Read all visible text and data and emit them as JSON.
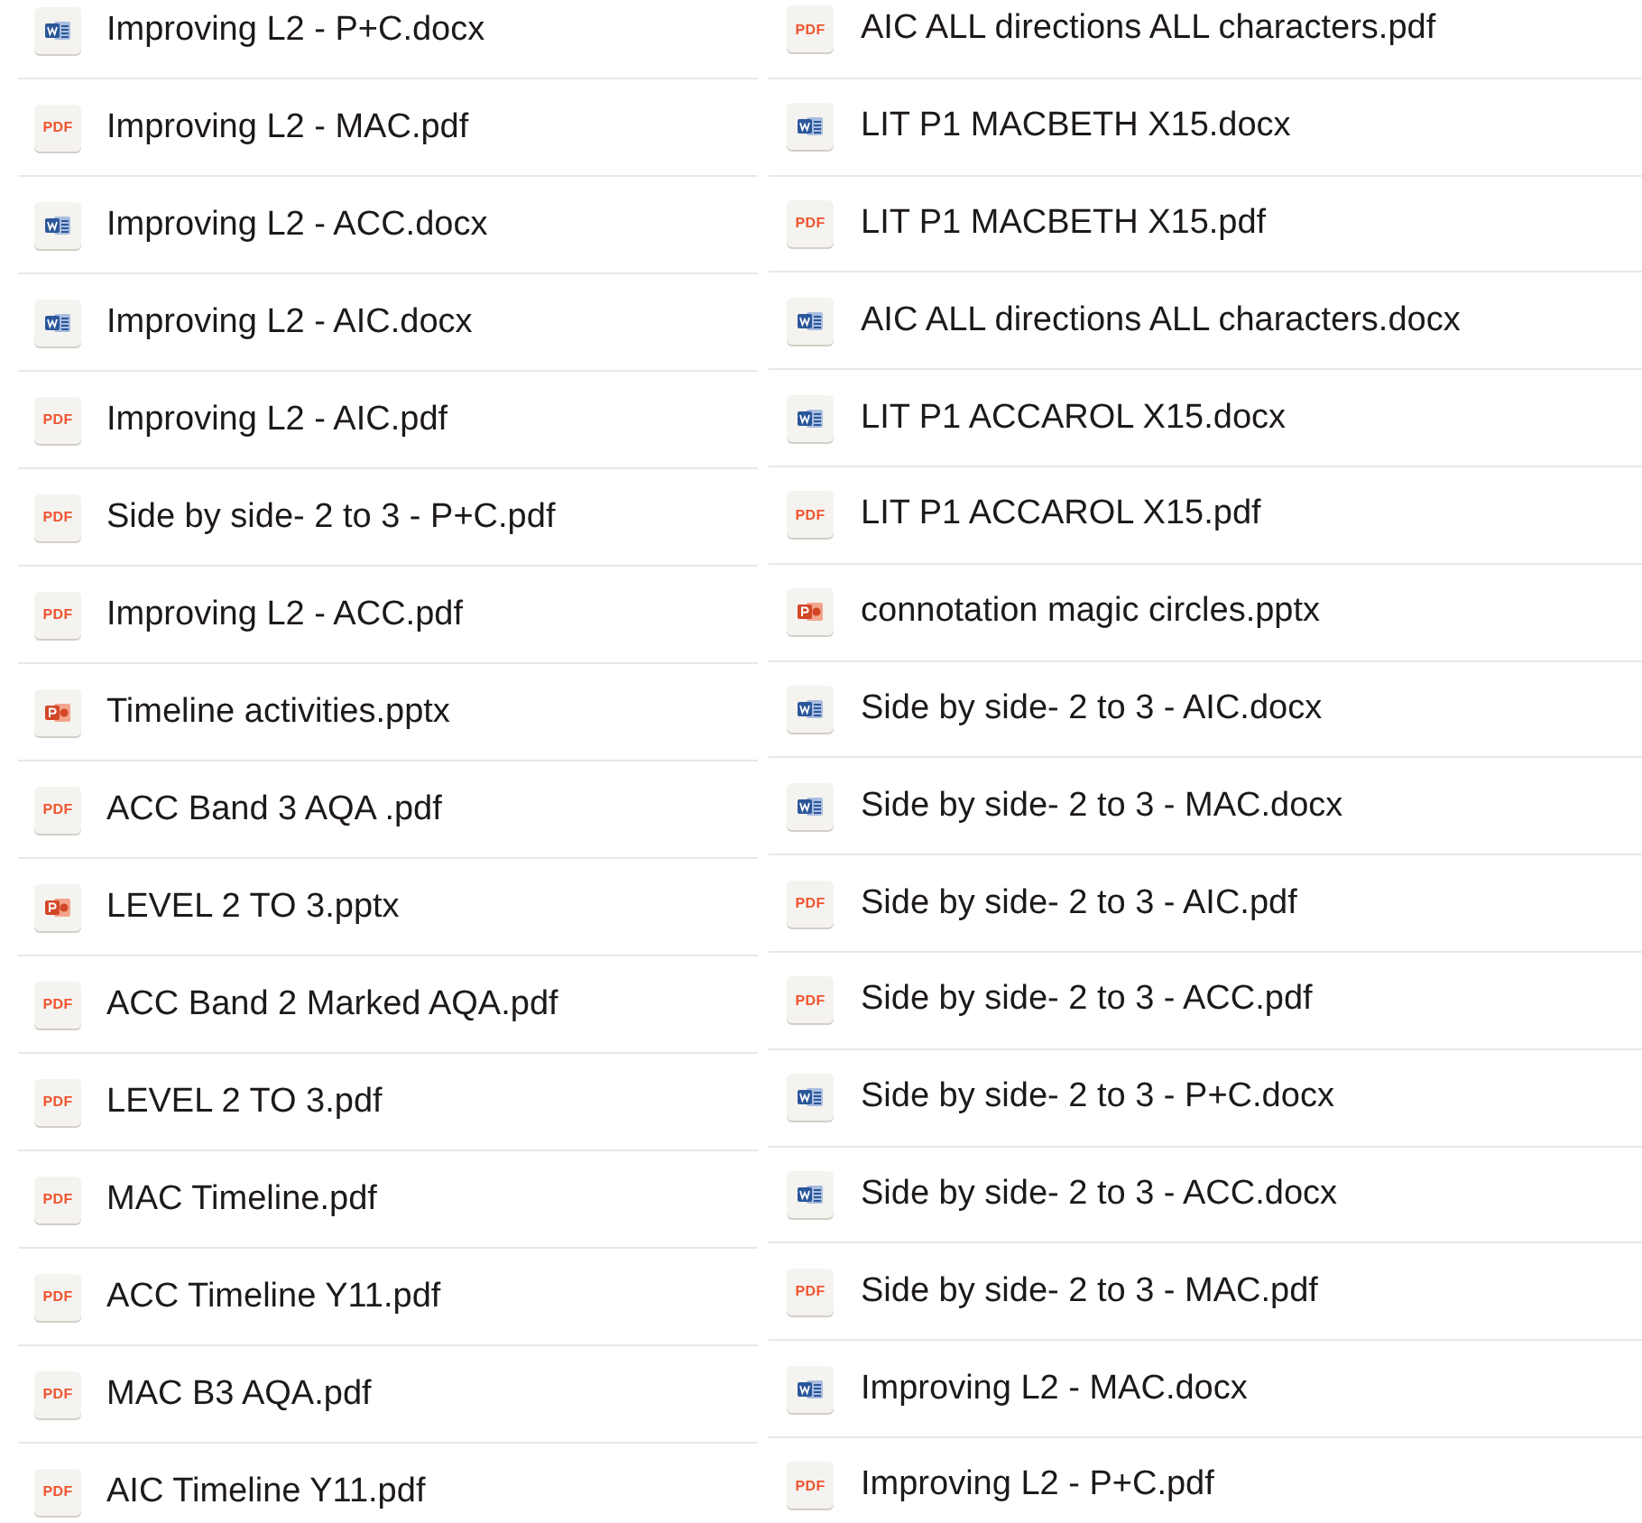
{
  "columns": [
    {
      "files": [
        {
          "name": "Improving L2 - P+C.docx",
          "kind": "docx"
        },
        {
          "name": "Improving L2 - MAC.pdf",
          "kind": "pdf",
          "badge": "PDF"
        },
        {
          "name": "Improving L2 - ACC.docx",
          "kind": "docx"
        },
        {
          "name": "Improving L2 - AIC.docx",
          "kind": "docx"
        },
        {
          "name": "Improving L2 - AIC.pdf",
          "kind": "pdf",
          "badge": "PDF"
        },
        {
          "name": "Side by side- 2 to 3 - P+C.pdf",
          "kind": "pdf",
          "badge": "PDF"
        },
        {
          "name": "Improving L2 - ACC.pdf",
          "kind": "pdf",
          "badge": "PDF"
        },
        {
          "name": "Timeline activities.pptx",
          "kind": "pptx"
        },
        {
          "name": "ACC Band 3 AQA .pdf",
          "kind": "pdf",
          "badge": "PDF"
        },
        {
          "name": "LEVEL 2 TO 3.pptx",
          "kind": "pptx"
        },
        {
          "name": "ACC Band 2 Marked AQA.pdf",
          "kind": "pdf",
          "badge": "PDF"
        },
        {
          "name": "LEVEL 2 TO 3.pdf",
          "kind": "pdf",
          "badge": "PDF"
        },
        {
          "name": "MAC Timeline.pdf",
          "kind": "pdf",
          "badge": "PDF"
        },
        {
          "name": "ACC Timeline Y11.pdf",
          "kind": "pdf",
          "badge": "PDF"
        },
        {
          "name": "MAC B3 AQA.pdf",
          "kind": "pdf",
          "badge": "PDF"
        },
        {
          "name": "AIC Timeline Y11.pdf",
          "kind": "pdf",
          "badge": "PDF"
        }
      ]
    },
    {
      "files": [
        {
          "name": "AIC ALL directions ALL characters.pdf",
          "kind": "pdf",
          "badge": "PDF"
        },
        {
          "name": "LIT P1 MACBETH X15.docx",
          "kind": "docx"
        },
        {
          "name": "LIT P1 MACBETH X15.pdf",
          "kind": "pdf",
          "badge": "PDF"
        },
        {
          "name": "AIC ALL directions ALL characters.docx",
          "kind": "docx"
        },
        {
          "name": "LIT P1 ACCAROL X15.docx",
          "kind": "docx"
        },
        {
          "name": "LIT P1 ACCAROL X15.pdf",
          "kind": "pdf",
          "badge": "PDF"
        },
        {
          "name": "connotation magic circles.pptx",
          "kind": "pptx"
        },
        {
          "name": "Side by side- 2 to 3 - AIC.docx",
          "kind": "docx"
        },
        {
          "name": "Side by side- 2 to 3 - MAC.docx",
          "kind": "docx"
        },
        {
          "name": "Side by side- 2 to 3 - AIC.pdf",
          "kind": "pdf",
          "badge": "PDF"
        },
        {
          "name": "Side by side- 2 to 3 - ACC.pdf",
          "kind": "pdf",
          "badge": "PDF"
        },
        {
          "name": "Side by side- 2 to 3 - P+C.docx",
          "kind": "docx"
        },
        {
          "name": "Side by side- 2 to 3 - ACC.docx",
          "kind": "docx"
        },
        {
          "name": "Side by side- 2 to 3 - MAC.pdf",
          "kind": "pdf",
          "badge": "PDF"
        },
        {
          "name": "Improving L2 - MAC.docx",
          "kind": "docx"
        },
        {
          "name": "Improving L2 - P+C.pdf",
          "kind": "pdf",
          "badge": "PDF"
        }
      ]
    }
  ]
}
